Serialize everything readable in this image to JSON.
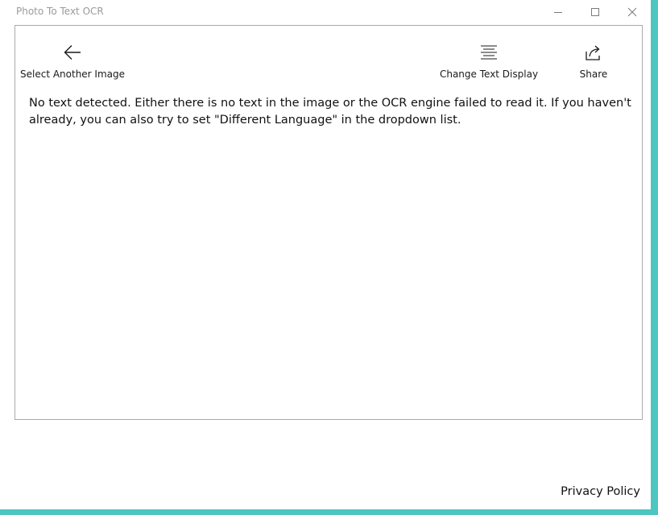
{
  "window": {
    "title": "Photo To Text OCR"
  },
  "toolbar": {
    "back_label": "Select Another Image",
    "display_label": "Change Text Display",
    "share_label": "Share"
  },
  "main": {
    "message": "No text detected. Either there is no text in the image or the OCR engine failed to read it. If you haven't already, you can also try to set \"Different Language\" in the dropdown list."
  },
  "footer": {
    "privacy_label": "Privacy Policy"
  },
  "icons": {
    "back": "arrow-left-icon",
    "display": "align-center-icon",
    "share": "share-icon"
  },
  "colors": {
    "accent_border": "#4cc6c0",
    "title_text": "#9a9a9a"
  }
}
